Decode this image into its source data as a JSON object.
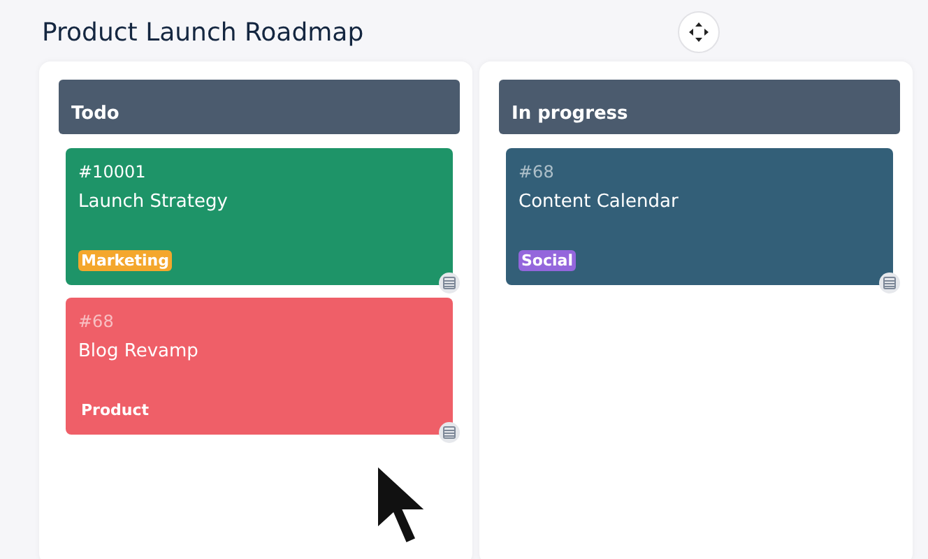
{
  "title": "Product Launch Roadmap",
  "columns": [
    {
      "title": "Todo",
      "cards": [
        {
          "id": "#10001",
          "id_muted": false,
          "title": "Launch Strategy",
          "color": "#1e9468",
          "tag": {
            "label": "Marketing",
            "color": "#f4a72c"
          }
        },
        {
          "id": "#68",
          "id_muted": true,
          "title": "Blog Revamp",
          "color": "#ef5f68",
          "tag": {
            "label": "Product",
            "color": "#ef5f68"
          }
        }
      ]
    },
    {
      "title": "In progress",
      "cards": [
        {
          "id": "#68",
          "id_muted": true,
          "title": "Content Calendar",
          "color": "#335f78",
          "tag": {
            "label": "Social",
            "color": "#9466dc"
          }
        }
      ]
    }
  ]
}
